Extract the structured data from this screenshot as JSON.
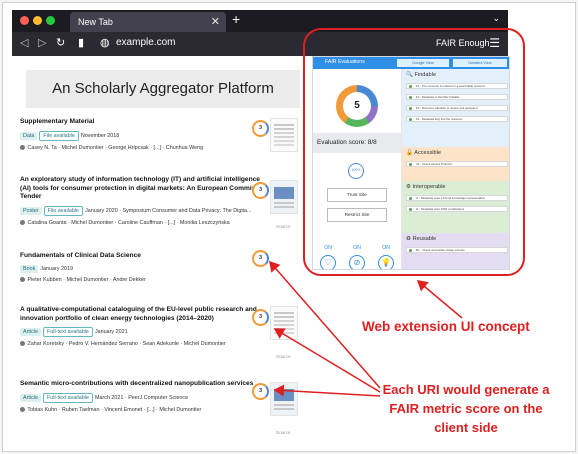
{
  "browser": {
    "tab_title": "New Tab",
    "tab_close": "✕",
    "new_tab": "+",
    "tab_menu": "⌄",
    "url": "example.com",
    "extension_button": "FAIR Enough"
  },
  "page": {
    "banner": "An Scholarly Aggregator Platform",
    "papers": [
      {
        "title": "Supplementary Material",
        "tags": [
          {
            "text": "Data",
            "style": "gray"
          },
          {
            "text": "File available",
            "style": "out"
          }
        ],
        "meta": "November 2018",
        "authors": "Casey N. Ta · Michel Dumontier · George Hripcsak · [...] · Chunhua Weng",
        "score": "3"
      },
      {
        "title": "An exploratory study of information technology (IT) and artificial intelligence (AI) tools for consumer protection in digital markets: An European Commission Tender",
        "tags": [
          {
            "text": "Poster",
            "style": "gray"
          },
          {
            "text": "File available",
            "style": "out"
          }
        ],
        "meta": "January 2020 · Symposium Consumer and Data Privacy: The Digita...",
        "authors": "Catalina Goanta · Michel Dumontier · Caroline Cauffman · [...] · Monika Leszczyńska",
        "score": "3",
        "source": "Source"
      },
      {
        "title": "Fundamentals of Clinical Data Science",
        "tags": [
          {
            "text": "Book",
            "style": "gray"
          }
        ],
        "meta": "January 2019",
        "authors": "Pieter Kubben · Michel Dumontier · Andre Dekker",
        "score": "3"
      },
      {
        "title": "A qualitative-computational cataloguing of the EU-level public research and innovation portfolio of clean energy technologies (2014–2020)",
        "tags": [
          {
            "text": "Article",
            "style": "gray"
          },
          {
            "text": "Full-text available",
            "style": "out"
          }
        ],
        "meta": "January 2021",
        "authors": "Zahar Koretsky · Pedro V. Hernández Serrano · Sean Adekunle · Michel Dumontier",
        "score": "3",
        "source": "Source"
      },
      {
        "title": "Semantic micro-contributions with decentralized nanopublication services",
        "tags": [
          {
            "text": "Article",
            "style": "gray"
          },
          {
            "text": "Full-text available",
            "style": "out"
          }
        ],
        "meta": "March 2021 · PeerJ Computer Science",
        "authors": "Tobias Kuhn · Ruben Taelman · Vincent Emonet · [...] · Michel Dumontier",
        "score": "3",
        "source": "Source"
      }
    ]
  },
  "popup": {
    "title": "FAIR Evaluations",
    "tab_left": "Google View",
    "tab_right": "Detailed View",
    "score": "5",
    "evaluation": "Evaluation score: 8/8",
    "percent": "100%",
    "trust_button": "Trust Site",
    "restrict_button": "Restrict Site",
    "toggles": [
      {
        "label": "ON",
        "icon": "♡"
      },
      {
        "label": "ON",
        "icon": "⊘"
      },
      {
        "label": "ON",
        "icon": "💡"
      }
    ],
    "sections": [
      {
        "name": "Findable",
        "icon": "🔍",
        "items": [
          "F1 - The resource is indexed in a searchable resource",
          "F2 - Metadata is identifier findable",
          "F3 - Resource Identifier is unique and persistent",
          "F4 - Metadata fully find the resource"
        ]
      },
      {
        "name": "Accessible",
        "icon": "🔓",
        "items": [
          "A1 - Check Access Protocol"
        ]
      },
      {
        "name": "Interoperable",
        "icon": "⚙",
        "items": [
          "I1 - Metadata uses a formal knowledge representation",
          "I2 - Metadata uses FAIR vocabularies"
        ]
      },
      {
        "name": "Reusable",
        "icon": "♻",
        "items": [
          "R1 - Check accessible Usage License"
        ]
      }
    ],
    "colors": {
      "header": "#2f8ee6",
      "findable": "#e3f0fb",
      "accessible": "#fde4c8",
      "interoperable": "#dcedd5",
      "reusable": "#e4dcf1"
    }
  },
  "annotations": {
    "extension_label": "Web extension UI concept",
    "score_label": "Each URI would generate a FAIR metric score on the client side"
  }
}
